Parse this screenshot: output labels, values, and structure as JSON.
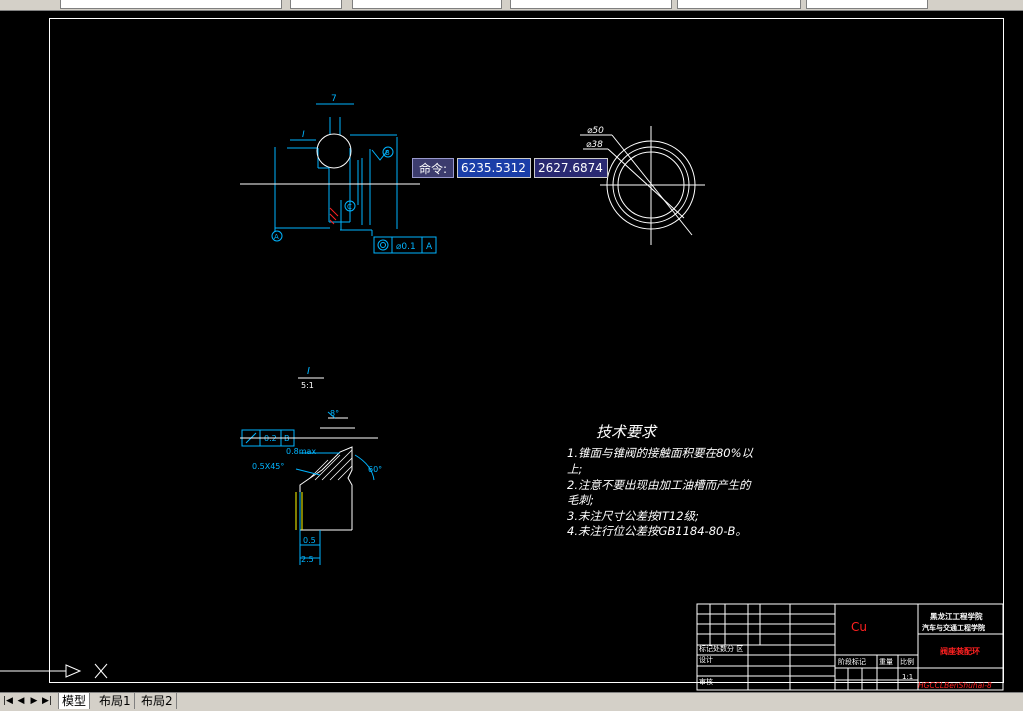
{
  "command_input": {
    "label": "命令:",
    "x_value": "6235.5312",
    "y_value": "2627.6874"
  },
  "tech_requirements": {
    "title": "技术要求",
    "lines": [
      "1.锥面与锥阀的接触面积要在80%以",
      "上;",
      "2.注意不要出现由加工油槽而产生的",
      "毛刺;",
      "3.未注尺寸公差按IT12级;",
      "4.未注行位公差按GB1184-80-B。"
    ]
  },
  "drawing_annotations": {
    "section_mark": "I",
    "section_scale": "5:1",
    "d50": "⌀50",
    "d38": "⌀38",
    "tol_value_top": "⌀0.1",
    "tol_datum_top": "A",
    "tol_value_detail": "0.2",
    "tol_datum_detail": "B",
    "chamfer_max": "0.8max",
    "chamfer": "0.5X45°",
    "dim_05": "0.5",
    "dim_25": "2.5",
    "dim_7": "7",
    "angle_8": "8°",
    "angle_60": "60°"
  },
  "title_block": {
    "material": "Cu",
    "school_line1": "黑龙江工程学院",
    "school_line2": "汽车与交通工程学院",
    "part_name": "阀座装配环",
    "drawing_no": "HGCCLBenShuhai-8",
    "scale": "1:1",
    "row_labels": [
      "标记处数分 区",
      "设计",
      "审核"
    ],
    "col_labels": [
      "阶段标记",
      "重量",
      "比例"
    ]
  },
  "tabs": {
    "model": "模型",
    "layout1": "布局1",
    "layout2": "布局2"
  },
  "colors": {
    "canvas": "#000000",
    "cyan": "#00b4ff",
    "red": "#ff2020",
    "white": "#ffffff"
  }
}
